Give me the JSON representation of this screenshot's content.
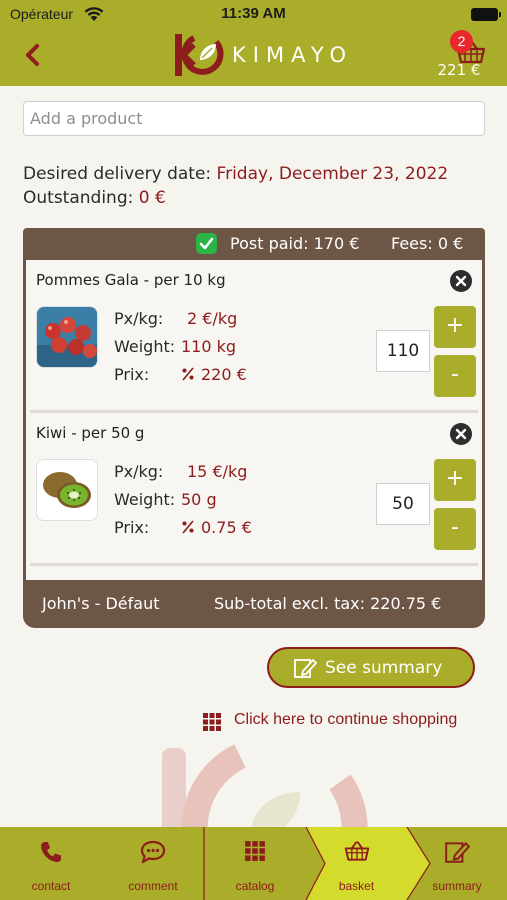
{
  "status_bar": {
    "carrier": "Opérateur",
    "time": "11:39 AM"
  },
  "header": {
    "brand": "KIMAYO",
    "cart_count": "2",
    "cart_total": "221 €"
  },
  "search": {
    "placeholder": "Add a product"
  },
  "delivery": {
    "date_label": "Desired delivery date:",
    "date_value": "Friday, December 23, 2022",
    "outstanding_label": "Outstanding:",
    "outstanding_value": "0 €"
  },
  "basket": {
    "post_paid": "Post paid: 170 €",
    "fees": "Fees: 0 €",
    "owner": "John's - Défaut",
    "subtotal": "Sub-total excl. tax: 220.75 €",
    "labels": {
      "price": "Px/kg:",
      "weight": "Weight:",
      "total": "Prix:"
    },
    "items": [
      {
        "name": "Pommes Gala - per 10 kg",
        "price": "2 €/kg",
        "weight": "110 kg",
        "total": "220 €",
        "quantity": "110",
        "image": "apples"
      },
      {
        "name": "Kiwi - per 50 g",
        "price": "15 €/kg",
        "weight": "50 g",
        "total": "0.75 €",
        "quantity": "50",
        "image": "kiwi"
      }
    ]
  },
  "actions": {
    "see_summary": "See summary",
    "continue_shopping": "Click here to continue shopping"
  },
  "tabs": [
    {
      "label": "contact",
      "icon": "phone-icon"
    },
    {
      "label": "comment",
      "icon": "chat-icon"
    },
    {
      "label": "catalog",
      "icon": "grid-icon"
    },
    {
      "label": "basket",
      "icon": "basket-icon",
      "active": true
    },
    {
      "label": "summary",
      "icon": "edit-icon"
    }
  ],
  "colors": {
    "brand_olive": "#a9ad2a",
    "accent_red": "#8d1c1c",
    "basket_brown": "#6e5646",
    "active_tab": "#d3db2c"
  }
}
